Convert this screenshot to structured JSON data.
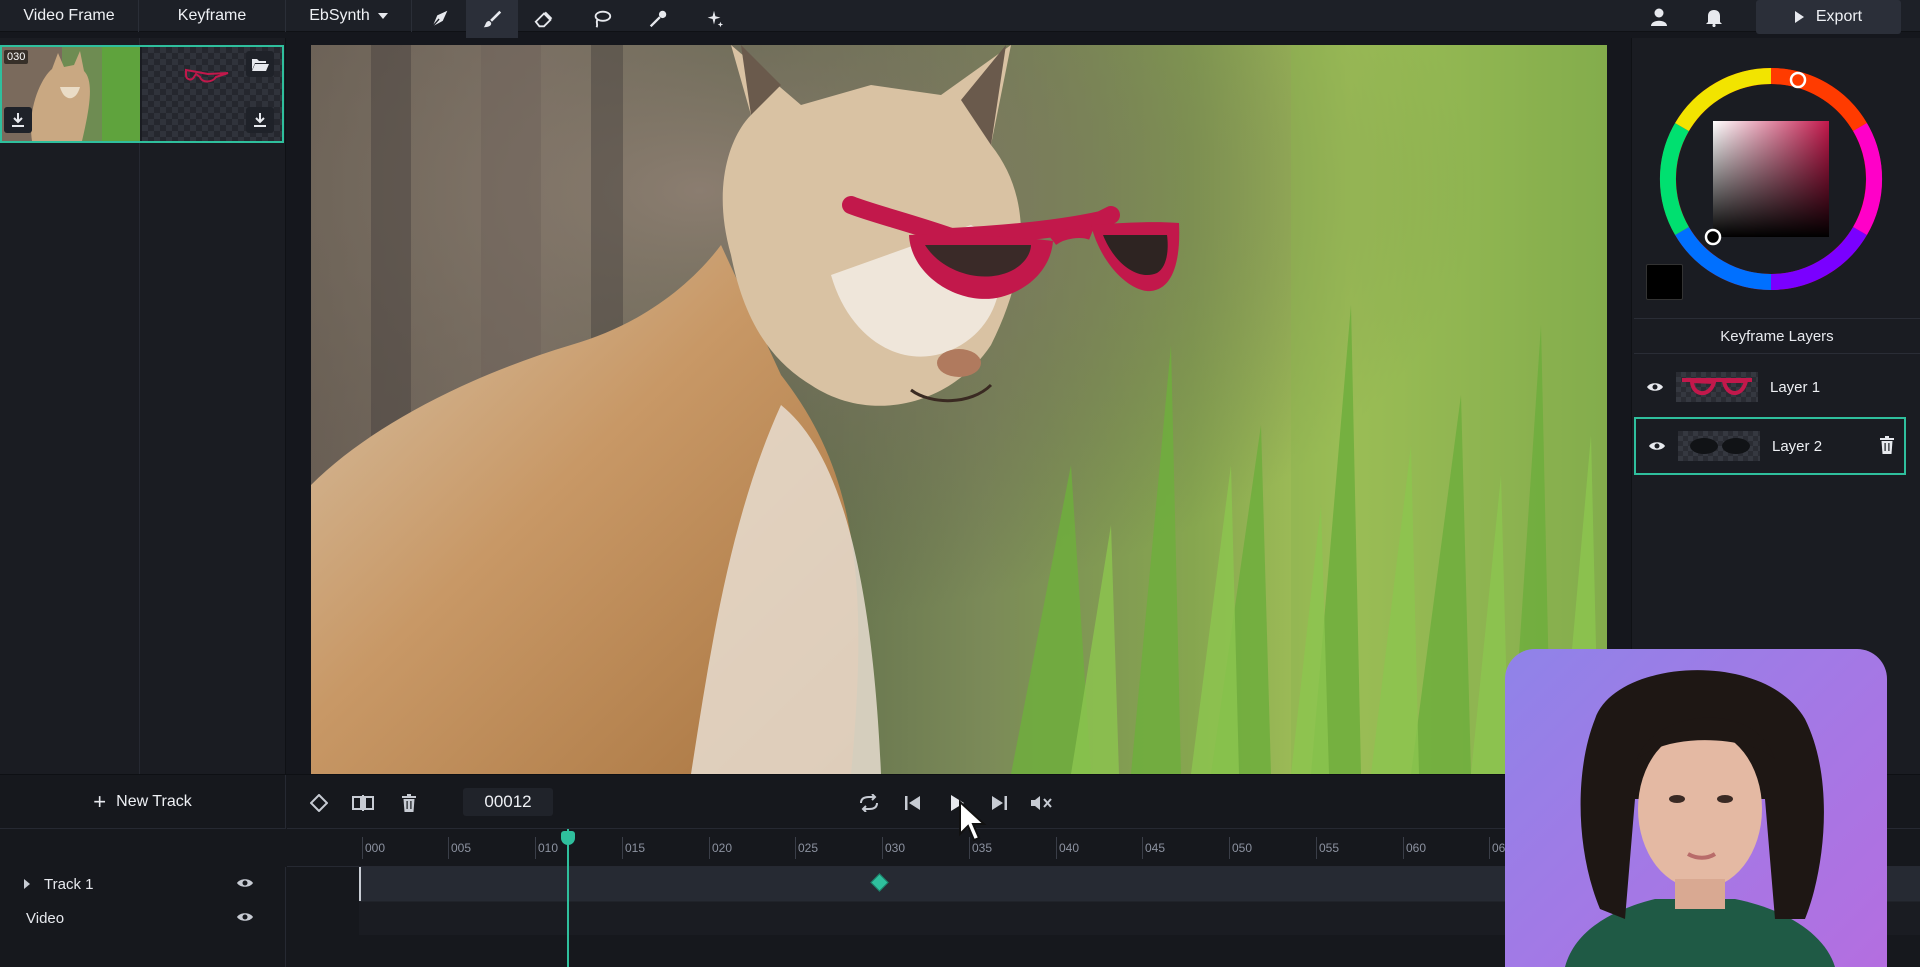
{
  "topbar": {
    "tab_video_frame": "Video Frame",
    "tab_keyframe": "Keyframe",
    "tab_ebsynth": "EbSynth",
    "tools": [
      "pen-tool-icon",
      "brush-icon",
      "eraser-icon",
      "lasso-icon",
      "eyedropper-icon",
      "magic-wand-icon"
    ],
    "active_tool": "brush-icon",
    "export_label": "Export"
  },
  "left_panel": {
    "frame_number": "030"
  },
  "right_panel": {
    "color_wheel": {
      "hue": "#c2184b",
      "selected_color": "#000000"
    },
    "keyframe_layers_title": "Keyframe Layers",
    "layers": [
      {
        "name": "Layer 1",
        "visible": true,
        "selected": false
      },
      {
        "name": "Layer 2",
        "visible": true,
        "selected": true
      }
    ]
  },
  "timeline": {
    "new_track_label": "New Track",
    "current_frame": "00012",
    "ruler_ticks": [
      "000",
      "005",
      "010",
      "015",
      "020",
      "025",
      "030",
      "035",
      "040",
      "045",
      "050",
      "055",
      "060",
      "06"
    ],
    "tracks": [
      {
        "name": "Track 1",
        "expandable": true
      },
      {
        "name": "Video",
        "expandable": false
      }
    ]
  },
  "colors": {
    "accent": "#2fbf9d",
    "panel_bg": "#1a1c22",
    "glasses_red": "#c2184b"
  }
}
